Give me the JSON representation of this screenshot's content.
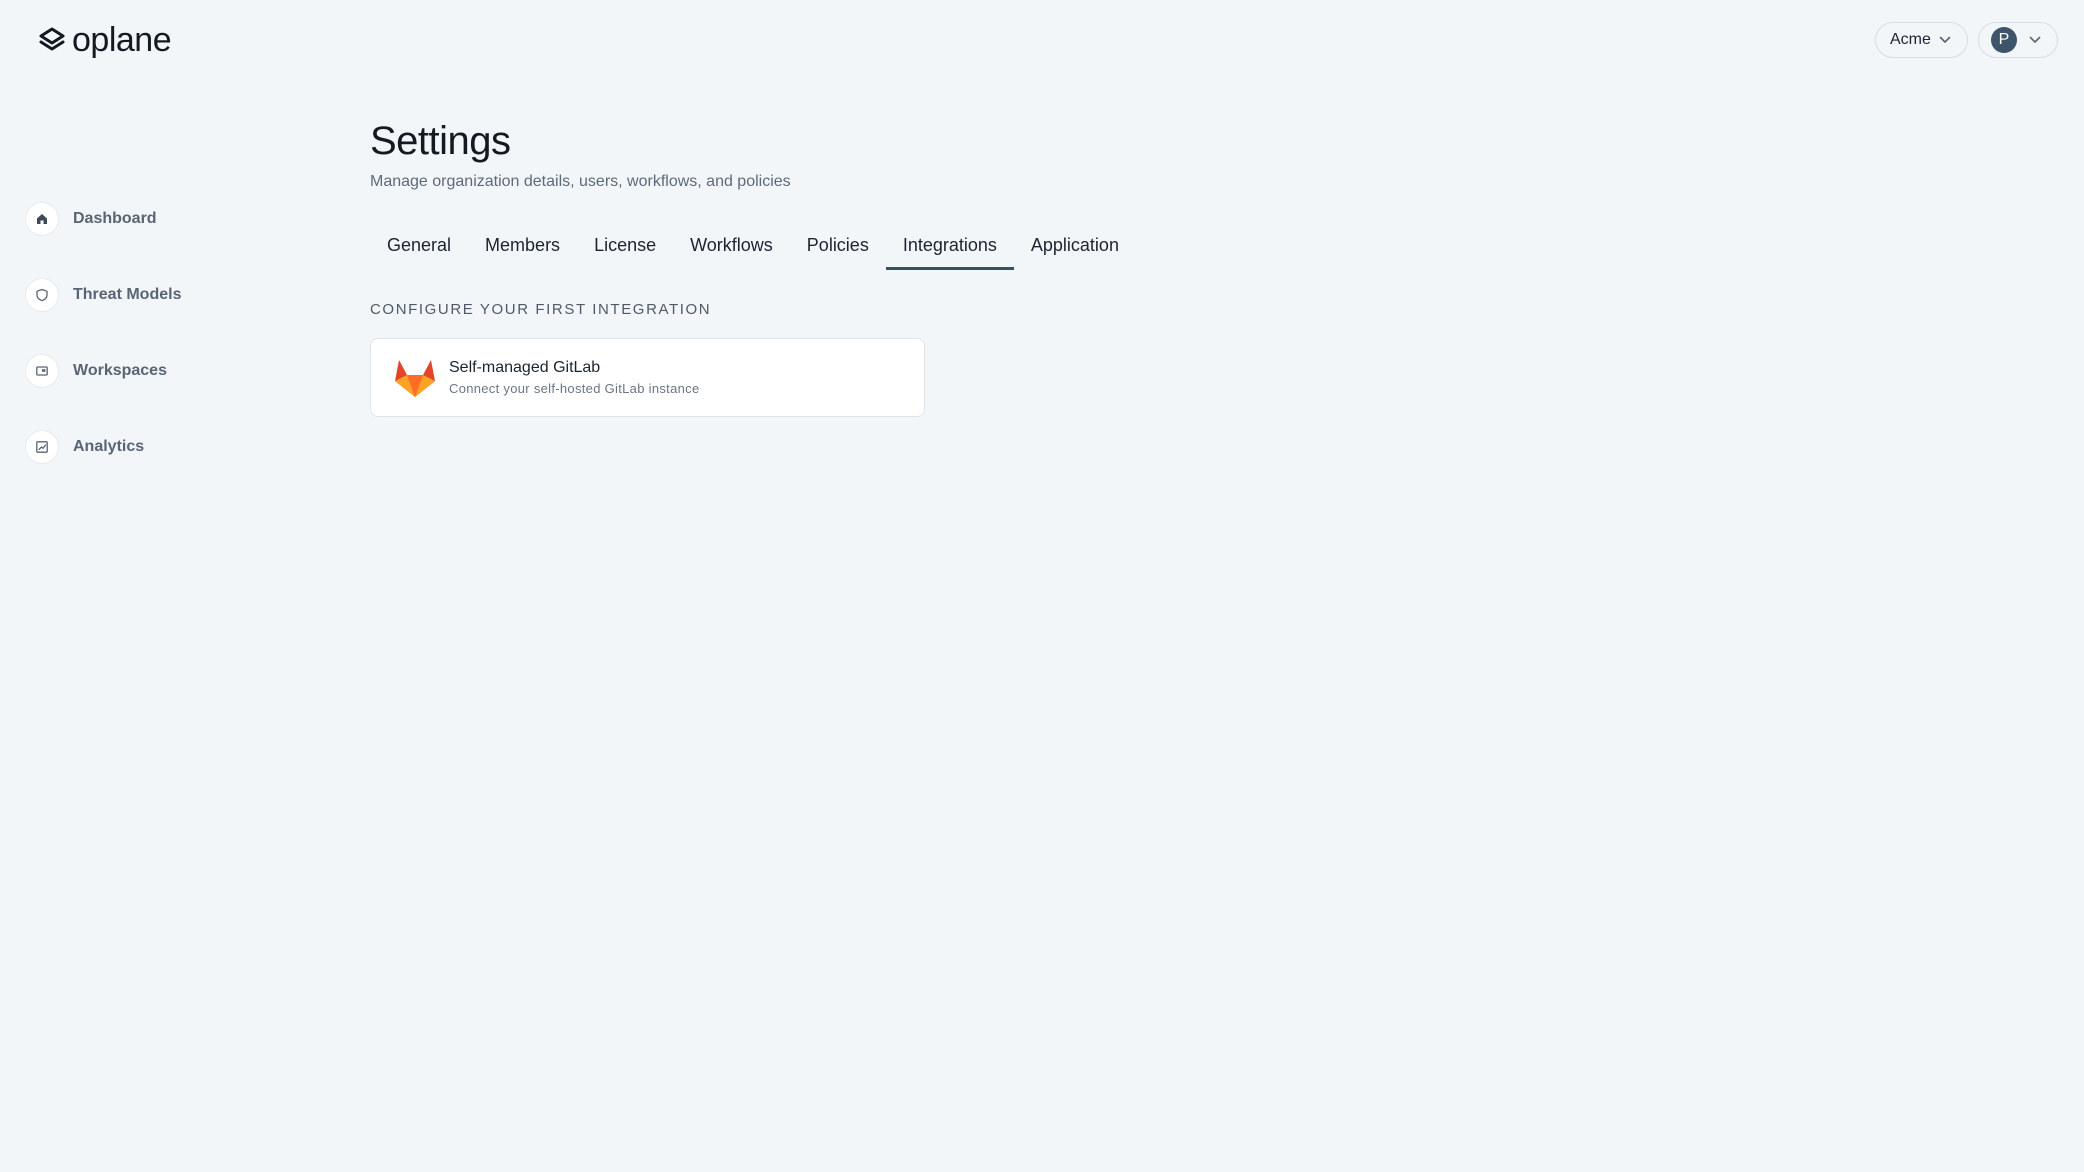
{
  "brand": {
    "name": "oplane"
  },
  "header": {
    "org_selector": {
      "label": "Acme"
    },
    "user_menu": {
      "avatar_initial": "P"
    }
  },
  "sidebar": {
    "items": [
      {
        "label": "Dashboard",
        "icon": "home-icon"
      },
      {
        "label": "Threat Models",
        "icon": "shield-icon"
      },
      {
        "label": "Workspaces",
        "icon": "workspace-icon"
      },
      {
        "label": "Analytics",
        "icon": "chart-icon"
      }
    ]
  },
  "page": {
    "title": "Settings",
    "subtitle": "Manage organization details, users, workflows, and policies"
  },
  "tabs": [
    {
      "label": "General",
      "active": false
    },
    {
      "label": "Members",
      "active": false
    },
    {
      "label": "License",
      "active": false
    },
    {
      "label": "Workflows",
      "active": false
    },
    {
      "label": "Policies",
      "active": false
    },
    {
      "label": "Integrations",
      "active": true
    },
    {
      "label": "Application",
      "active": false
    }
  ],
  "integrations": {
    "section_label": "CONFIGURE YOUR FIRST INTEGRATION",
    "cards": [
      {
        "title": "Self-managed GitLab",
        "description": "Connect your self-hosted GitLab instance",
        "icon": "gitlab-icon"
      }
    ]
  },
  "colors": {
    "background": "#f2f6f9",
    "active_tab_underline": "#3b4f63",
    "avatar": "#3e546b",
    "gitlab_orange": "#e2432a"
  }
}
